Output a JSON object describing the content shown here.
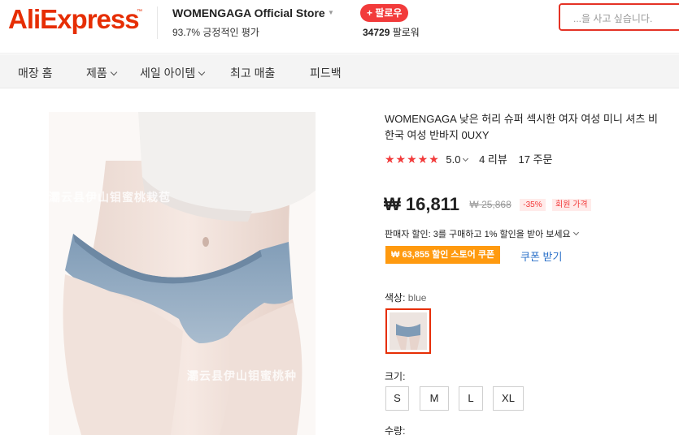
{
  "header": {
    "logo_text": "AliExpress",
    "logo_tm": "™",
    "store_name": "WOMENGAGA Official Store",
    "store_positive_pct": "93.7%",
    "store_positive_label": "긍정적인 평가",
    "follow_label": "+ 팔로우",
    "followers_count": "34729",
    "followers_label": "팔로워",
    "search_placeholder": "...을 사고 싶습니다.",
    "brand_color": "#e62e04"
  },
  "nav": {
    "items": [
      {
        "label": "매장 홈",
        "has_dropdown": false
      },
      {
        "label": "제품",
        "has_dropdown": true
      },
      {
        "label": "세일 아이템",
        "has_dropdown": true
      },
      {
        "label": "최고 매출",
        "has_dropdown": false
      },
      {
        "label": "피드백",
        "has_dropdown": false
      }
    ]
  },
  "product": {
    "image_watermark_1": "灞云县伊山钼蜜桃栽苞",
    "image_watermark_2": "灞云县伊山钼蜜桃种",
    "title_line1": "WOMENGAGA 낮은 허리 슈퍼 섹시한 여자 여성 미니 셔츠 비",
    "title_line2": "한국 여성 반바지 0UXY",
    "stars": "★★★★★",
    "rating": "5.0",
    "reviews": "4 리뷰",
    "orders": "17 주문",
    "price": "₩ 16,811",
    "original_price": "₩ 25,868",
    "discount": "-35%",
    "member_price_label": "회원 가격",
    "seller_discount": "판매자 할인: 3를 구매하고 1% 할인을 받아 보세요",
    "coupon": "₩ 63,855 할인 스토어 쿠폰",
    "coupon_link": "쿠폰 받기",
    "color_label": "색상:",
    "color_value": "blue",
    "size_label": "크기:",
    "sizes": [
      "S",
      "M",
      "L",
      "XL"
    ],
    "quantity_label": "수량:"
  }
}
